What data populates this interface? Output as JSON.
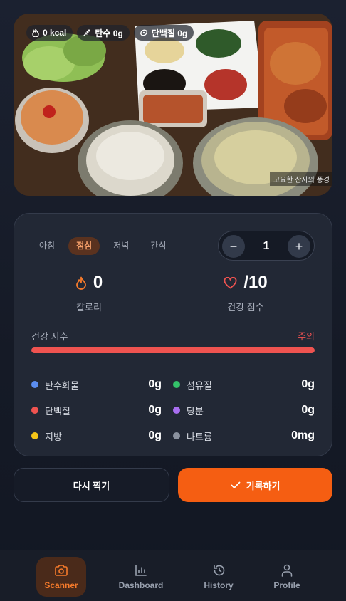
{
  "photo": {
    "chips": [
      {
        "icon": "flame-icon",
        "label": "0 kcal"
      },
      {
        "icon": "wheat-icon",
        "label": "탄수 0g"
      },
      {
        "icon": "protein-icon",
        "label": "단백질 0g"
      }
    ],
    "watermark": "고요한 산사의 풍경"
  },
  "meal_tabs": [
    {
      "label": "아침",
      "active": false
    },
    {
      "label": "점심",
      "active": true
    },
    {
      "label": "저녁",
      "active": false
    },
    {
      "label": "간식",
      "active": false
    }
  ],
  "stepper": {
    "minus": "−",
    "value": "1",
    "plus": "+"
  },
  "stats": {
    "calories": {
      "value": "0",
      "label": "칼로리"
    },
    "health_score": {
      "value": "/10",
      "label": "건강 점수"
    }
  },
  "health_index": {
    "label": "건강 지수",
    "status": "주의",
    "progress": 1.0,
    "color": "#ef5350"
  },
  "nutrients": [
    {
      "name": "탄수화물",
      "value": "0g",
      "color": "#5b8def"
    },
    {
      "name": "섬유질",
      "value": "0g",
      "color": "#34c26a"
    },
    {
      "name": "단백질",
      "value": "0g",
      "color": "#ef5350"
    },
    {
      "name": "당분",
      "value": "0g",
      "color": "#a86ef0"
    },
    {
      "name": "지방",
      "value": "0g",
      "color": "#f5c518"
    },
    {
      "name": "나트륨",
      "value": "0mg",
      "color": "#8a919e"
    }
  ],
  "actions": {
    "retake": "다시 찍기",
    "save": "기록하기"
  },
  "nav": [
    {
      "label": "Scanner",
      "icon": "camera-icon",
      "active": true
    },
    {
      "label": "Dashboard",
      "icon": "bar-chart-icon",
      "active": false
    },
    {
      "label": "History",
      "icon": "history-icon",
      "active": false
    },
    {
      "label": "Profile",
      "icon": "user-icon",
      "active": false
    }
  ],
  "colors": {
    "accent": "#f55e12",
    "card": "#222835",
    "background": "#151a26"
  }
}
